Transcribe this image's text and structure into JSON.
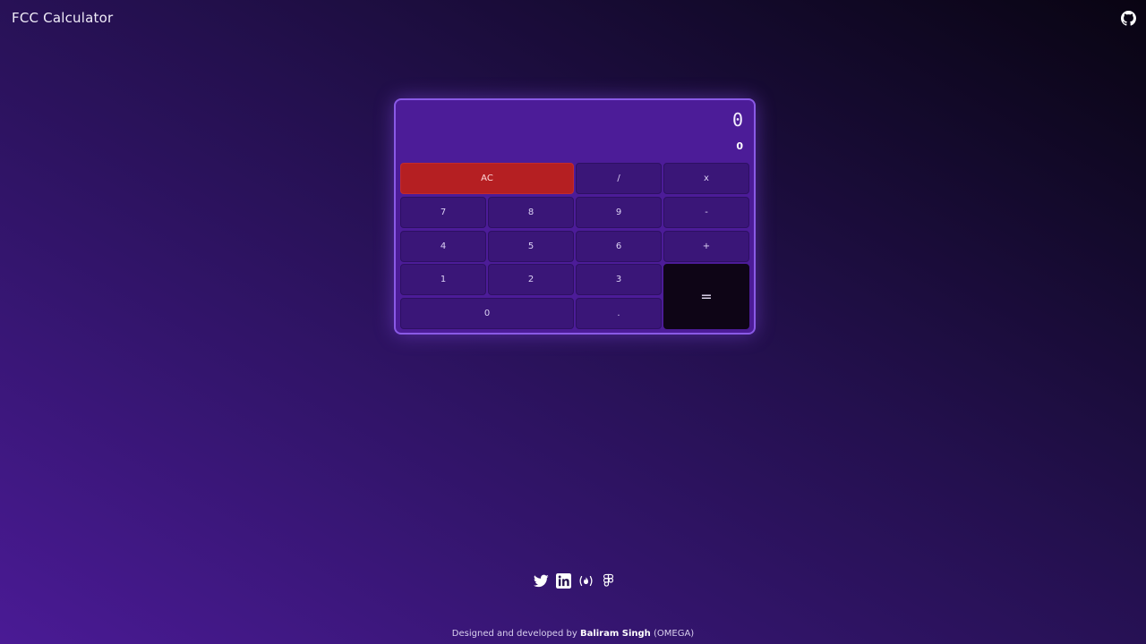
{
  "header": {
    "title": "FCC Calculator",
    "github_icon": "github-icon"
  },
  "calculator": {
    "formula": "0",
    "output": "0",
    "keys": {
      "clear": "AC",
      "divide": "/",
      "multiply": "x",
      "seven": "7",
      "eight": "8",
      "nine": "9",
      "subtract": "-",
      "four": "4",
      "five": "5",
      "six": "6",
      "add": "+",
      "one": "1",
      "two": "2",
      "three": "3",
      "equals": "=",
      "zero": "0",
      "decimal": "."
    }
  },
  "footer": {
    "socials": [
      "twitter-icon",
      "linkedin-icon",
      "freecodecamp-icon",
      "figma-icon"
    ],
    "credit_prefix": "Designed and developed by",
    "author": "Baliram Singh",
    "alias": "(OMEGA)"
  },
  "colors": {
    "calculator_bg": "#4c1c98",
    "key_bg": "#3a1678",
    "clear_bg": "#b51f22",
    "equals_bg": "#0e0516",
    "border_accent": "#8a5ae6"
  }
}
